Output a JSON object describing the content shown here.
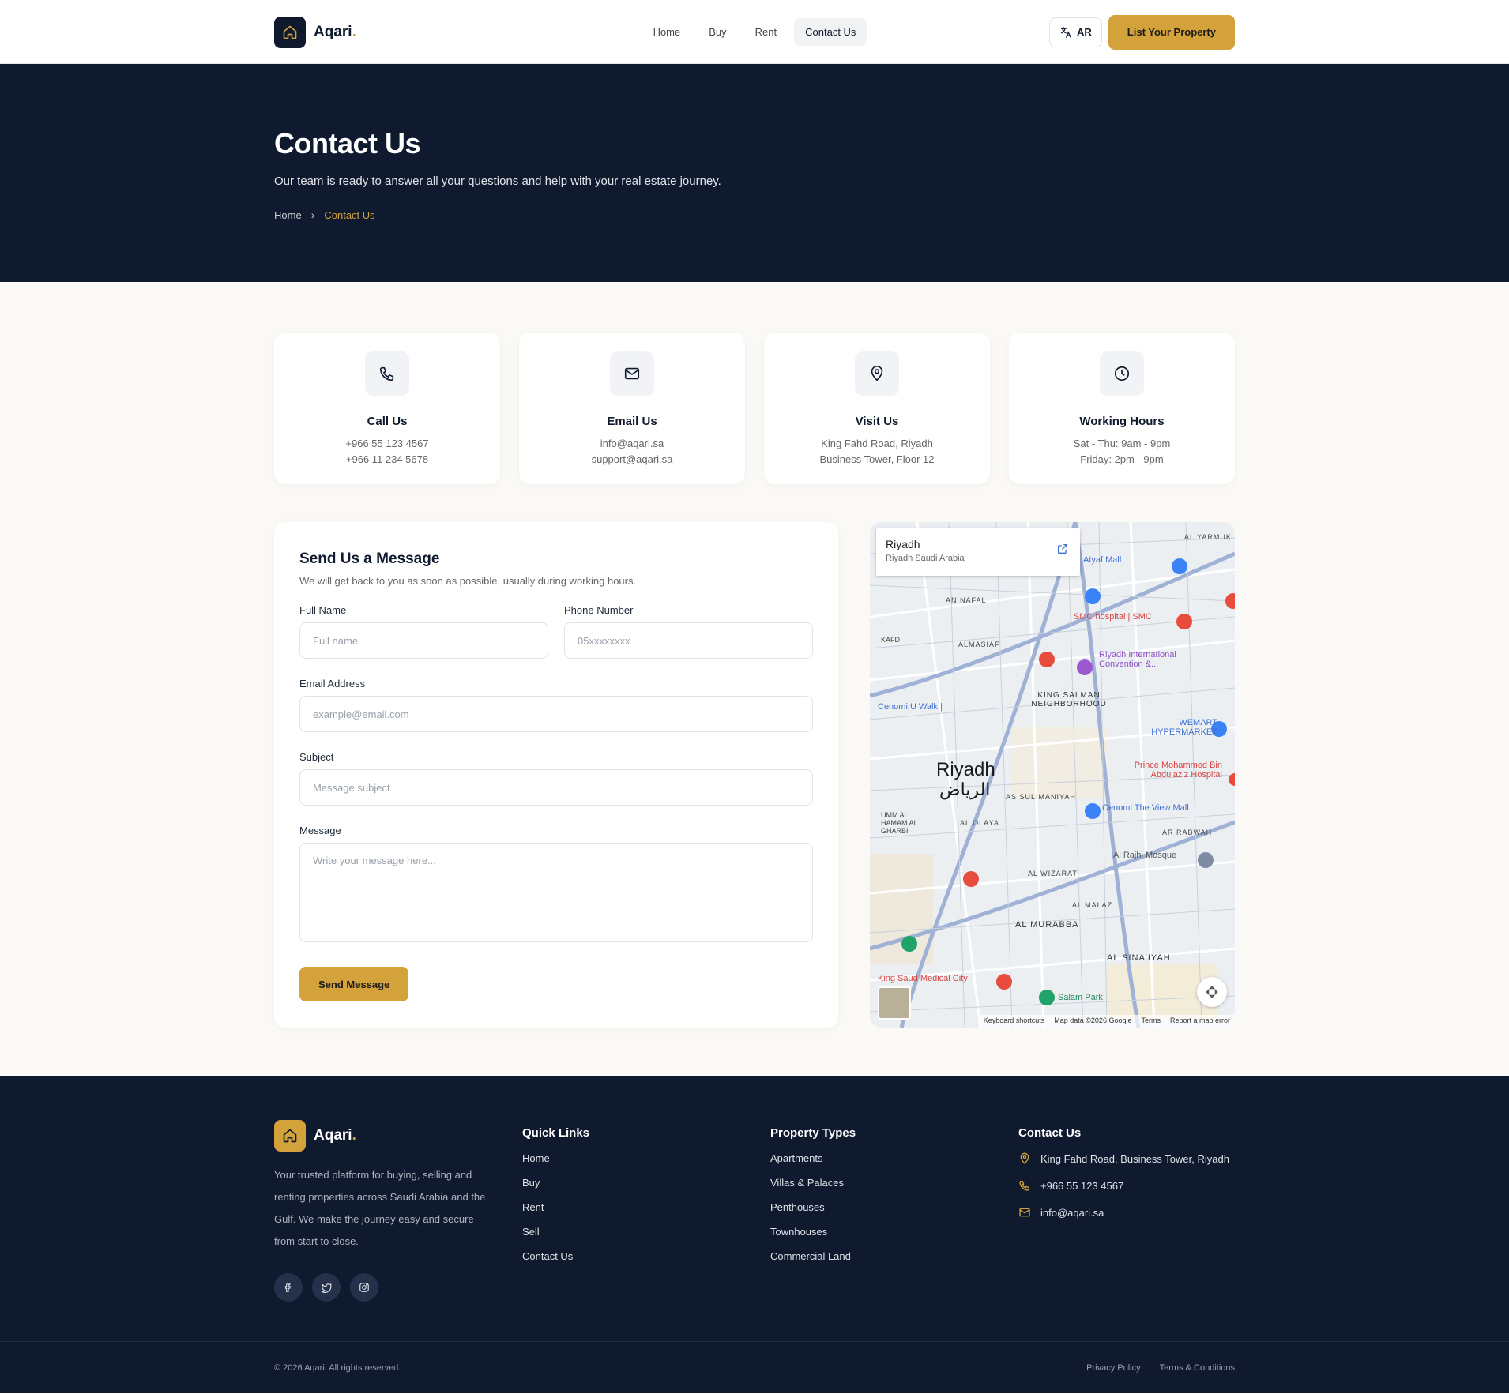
{
  "brand": {
    "name": "Aqari",
    "dot": "."
  },
  "nav": {
    "home": "Home",
    "buy": "Buy",
    "rent": "Rent",
    "contact": "Contact Us"
  },
  "header": {
    "lang": "AR",
    "cta": "List Your Property"
  },
  "hero": {
    "title": "Contact Us",
    "subtitle": "Our team is ready to answer all your questions and help with your real estate journey.",
    "crumb_home": "Home",
    "crumb_current": "Contact Us"
  },
  "cards": [
    {
      "icon": "phone-icon",
      "title": "Call Us",
      "line1": "+966 55 123 4567",
      "line2": "+966 11 234 5678"
    },
    {
      "icon": "mail-icon",
      "title": "Email Us",
      "line1": "info@aqari.sa",
      "line2": "support@aqari.sa"
    },
    {
      "icon": "map-pin-icon",
      "title": "Visit Us",
      "line1": "King Fahd Road, Riyadh",
      "line2": "Business Tower, Floor 12"
    },
    {
      "icon": "clock-icon",
      "title": "Working Hours",
      "line1": "Sat - Thu: 9am - 9pm",
      "line2": "Friday: 2pm - 9pm"
    }
  ],
  "form": {
    "title": "Send Us a Message",
    "desc": "We will get back to you as soon as possible, usually during working hours.",
    "name_label": "Full Name",
    "name_ph": "Full name",
    "phone_label": "Phone Number",
    "phone_ph": "05xxxxxxxx",
    "email_label": "Email Address",
    "email_ph": "example@email.com",
    "subject_label": "Subject",
    "subject_ph": "Message subject",
    "message_label": "Message",
    "message_ph": "Write your message here...",
    "submit": "Send Message"
  },
  "map": {
    "place": "Riyadh",
    "place_sub": "Riyadh Saudi Arabia",
    "city": "Riyadh",
    "city_ar": "الرياض",
    "labels": {
      "atyaf": "Atyaf Mall",
      "smc": "SMC hospital | SMC",
      "ricc": "Riyadh International Convention &...",
      "ksn": "KING SALMAN NEIGHBORHOOD",
      "cenomi_u": "Cenomi U Walk |",
      "wemart": "WEMART HYPERMARKET",
      "pmbah": "Prince Mohammed Bin Abdulaziz Hospital",
      "sulaimaniyah": "AS SULIMANIYAH",
      "view_mall": "Cenomi The View Mall",
      "olaya": "AL OLAYA",
      "rajhi": "Al Rajhi Mosque",
      "wizarat": "AL WIZARAT",
      "malaz": "AL MALAZ",
      "murabba": "AL MURABBA",
      "sinaiyah": "AL SINA'IYAH",
      "ksmc": "King Saud Medical City",
      "salam": "Salam Park",
      "nafal": "AN NAFAL",
      "almasiaf": "ALMASIAF",
      "kafd": "KAFD",
      "umm_hamam": "UMM AL HAMAM AL GHARBI",
      "yarmuk": "AL YARMUK",
      "ar_rabwah": "AR RABWAH"
    },
    "attr": {
      "keys": "Keyboard shortcuts",
      "data": "Map data ©2026 Google",
      "terms": "Terms",
      "report": "Report a map error"
    }
  },
  "footer": {
    "about": "Your trusted platform for buying, selling and renting properties across Saudi Arabia and the Gulf. We make the journey easy and secure from start to close.",
    "quick_title": "Quick Links",
    "quick": [
      "Home",
      "Buy",
      "Rent",
      "Sell",
      "Contact Us"
    ],
    "types_title": "Property Types",
    "types": [
      "Apartments",
      "Villas & Palaces",
      "Penthouses",
      "Townhouses",
      "Commercial Land"
    ],
    "contact_title": "Contact Us",
    "address": "King Fahd Road, Business Tower, Riyadh",
    "phone": "+966 55 123 4567",
    "email": "info@aqari.sa",
    "copyright": "© 2026 Aqari. All rights reserved.",
    "privacy": "Privacy Policy",
    "terms": "Terms & Conditions"
  },
  "colors": {
    "navy": "#0f1a2e",
    "gold": "#d4a23a",
    "bg": "#faf9f6"
  }
}
